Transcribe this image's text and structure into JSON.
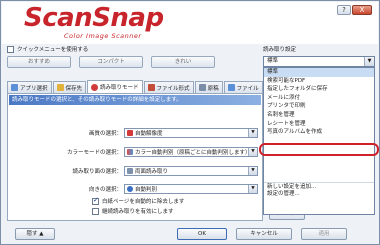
{
  "title_bar": {
    "logo": "ScanSnap",
    "logo_sub": "Color Image Scanner",
    "help": "?",
    "close": "X"
  },
  "quick_menu": {
    "checkbox_label": "クイックメニューを使用する",
    "checked": false,
    "presets": [
      "おすすめ",
      "コンパクト",
      "きれい"
    ]
  },
  "settings": {
    "label": "読み取り設定",
    "selected": "標準",
    "options": [
      "標準",
      "検索可能なPDF",
      "指定したフォルダに保存",
      "メールに添付",
      "プリンタで印刷",
      "名刺を管理",
      "レシートを管理",
      "写真のアルバムを作成",
      "新しい設定を追加...",
      "設定の管理..."
    ],
    "highlighted_index": 8
  },
  "tabs": [
    {
      "label": "アプリ選択",
      "icon": "app-icon",
      "active": false
    },
    {
      "label": "保存先",
      "icon": "folder-icon",
      "active": false
    },
    {
      "label": "読み取りモード",
      "icon": "scan-mode-icon",
      "active": true
    },
    {
      "label": "ファイル形式",
      "icon": "file-format-icon",
      "active": false
    },
    {
      "label": "原稿",
      "icon": "paper-icon",
      "active": false
    },
    {
      "label": "ファイル",
      "icon": "file-size-icon",
      "active": false
    }
  ],
  "panel": {
    "banner": "読み取りモードの選択と、その読み取りモードの詳細を設定します。",
    "fields": [
      {
        "label": "画質の選択：",
        "value": "自動解像度",
        "icon": "auto-res-icon"
      },
      {
        "label": "カラーモードの選択：",
        "value": "カラー自動判別（原稿ごとに自動判別します）",
        "icon": "color-mode-icon"
      },
      {
        "label": "読み取り面の選択：",
        "value": "両面読み取り",
        "icon": "duplex-icon"
      },
      {
        "label": "向きの選択：",
        "value": "自動判別",
        "icon": "rotate-icon"
      }
    ],
    "checkboxes": [
      {
        "label": "白紙ページを自動的に除去します",
        "checked": true
      },
      {
        "label": "継続読み取りを有効にします",
        "checked": false
      }
    ],
    "option_button": "オプション..."
  },
  "footer": {
    "hide": "隠す",
    "ok": "OK",
    "cancel": "キャンセル",
    "apply": "適用"
  },
  "colors": {
    "brand": "#c8242b",
    "accent": "#4a78c4",
    "highlight_ring": "#d0212a"
  }
}
